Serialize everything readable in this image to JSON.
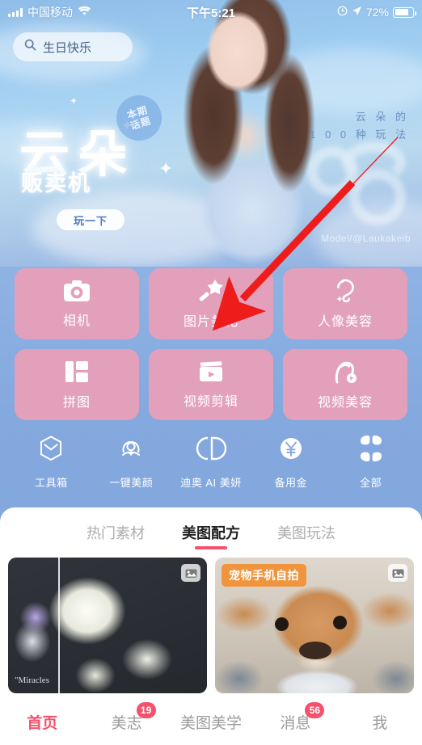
{
  "status_bar": {
    "carrier": "中国移动",
    "wifi_icon": "wifi-icon",
    "time": "下午5:21",
    "alarm_icon": "alarm-icon",
    "location_icon": "location-arrow-icon",
    "battery_percent": "72%"
  },
  "search": {
    "icon": "search-icon",
    "value": "生日快乐"
  },
  "banner": {
    "title": "云朵",
    "subtitle": "贩卖机",
    "badge_line1": "本期",
    "badge_line2": "话题",
    "play_button": "玩一下",
    "side_line1": "云 朵 的",
    "side_line2": "1 0 0 种 玩 法",
    "credit": "Model/@Laukakeib",
    "watermark_number": "03"
  },
  "tiles": [
    {
      "label": "相机",
      "icon": "camera-icon"
    },
    {
      "label": "图片美化",
      "icon": "magic-wand-icon"
    },
    {
      "label": "人像美容",
      "icon": "portrait-beauty-icon"
    },
    {
      "label": "拼图",
      "icon": "collage-icon"
    },
    {
      "label": "视频剪辑",
      "icon": "video-clapper-icon"
    },
    {
      "label": "视频美容",
      "icon": "video-portrait-icon"
    }
  ],
  "icon_row": [
    {
      "label": "工具箱",
      "icon": "toolbox-icon"
    },
    {
      "label": "一键美颜",
      "icon": "one-tap-beauty-icon"
    },
    {
      "label": "迪奥 AI 美妍",
      "icon": "dior-cd-logo-icon"
    },
    {
      "label": "备用金",
      "icon": "yuan-coin-icon"
    },
    {
      "label": "全部",
      "icon": "grid-all-icon"
    }
  ],
  "tabs": [
    {
      "label": "热门素材",
      "active": false
    },
    {
      "label": "美图配方",
      "active": true
    },
    {
      "label": "美图玩法",
      "active": false
    }
  ],
  "cards": [
    {
      "name": "rose-photo-card",
      "caption": "\"Miracles",
      "badge_icon": "image-stack-icon"
    },
    {
      "name": "dog-selfie-card",
      "label": "宠物手机自拍",
      "badge_icon": "image-stack-icon"
    }
  ],
  "bottom_nav": [
    {
      "label": "首页",
      "badge": null,
      "active": true
    },
    {
      "label": "美志",
      "badge": "19",
      "active": false
    },
    {
      "label": "美图美学",
      "badge": null,
      "active": false
    },
    {
      "label": "消息",
      "badge": "56",
      "active": false
    },
    {
      "label": "我",
      "badge": null,
      "active": false
    }
  ],
  "annotation": {
    "type": "red-arrow",
    "color": "#ef1c1c",
    "points_to": "图片美化"
  },
  "colors": {
    "tile_pink": "#e3a0bb",
    "page_blue": "#80a4de",
    "accent_red": "#f4516c",
    "badge_orange": "#f0953d"
  }
}
